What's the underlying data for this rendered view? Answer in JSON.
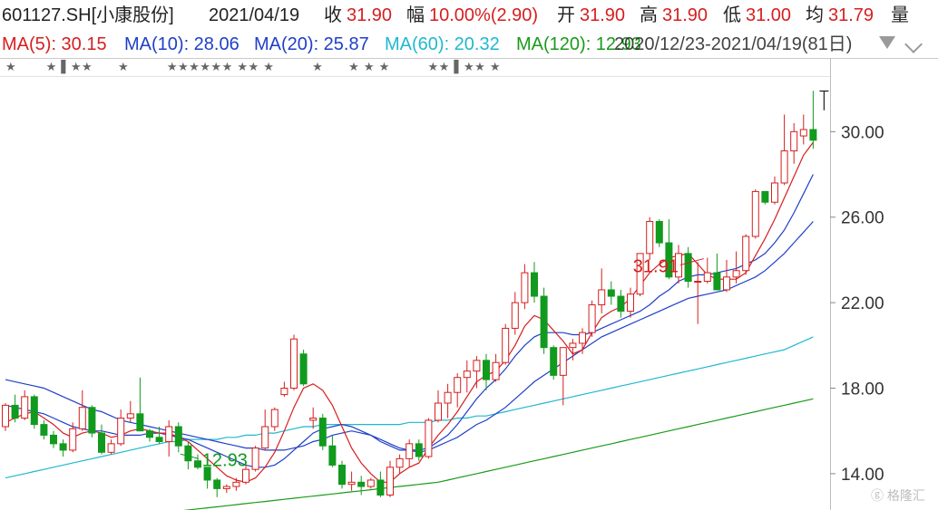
{
  "header": {
    "stock": "601127.SH[小康股份]",
    "date": "2021/04/19",
    "close_label": "收",
    "close": "31.90",
    "change_label": "幅",
    "change": "10.00%(2.90)",
    "open_label": "开",
    "open": "31.90",
    "high_label": "高",
    "high": "31.90",
    "low_label": "低",
    "low": "31.00",
    "avg_label": "均",
    "avg": "31.79",
    "vol_label": "量",
    "range": "2020/12/23-2021/04/19(81日)"
  },
  "ma_legend": [
    {
      "text": "MA(5): 30.15",
      "color": "#d61e1e"
    },
    {
      "text": "MA(10): 28.06",
      "color": "#1f3fc8"
    },
    {
      "text": "MA(20): 25.87",
      "color": "#1f3fc8"
    },
    {
      "text": "MA(60): 20.32",
      "color": "#1fb8d0"
    },
    {
      "text": "MA(120): 12.93",
      "color": "#1a9a1a"
    }
  ],
  "watermark": "ⓖ 格隆汇",
  "chart_data": {
    "type": "candlestick",
    "ylim": [
      12.3,
      32.6
    ],
    "yticks": [
      "30.00",
      "26.00",
      "22.00",
      "18.00",
      "14.00"
    ],
    "ytick_values": [
      30,
      26,
      22,
      18,
      14
    ],
    "colors": {
      "up": "#d61e1e",
      "down": "#119a1e",
      "ma5": "#d61e1e",
      "ma10": "#1f3fc8",
      "ma20": "#1f3fc8",
      "ma60": "#1fb8d0",
      "ma120": "#1a9a1a",
      "ma250": "#b21fb2"
    },
    "annotations": [
      {
        "text": "31.91",
        "type": "high",
        "color": "#d61e1e",
        "index": 73
      },
      {
        "text": "12.93",
        "type": "low",
        "color": "#119a1e",
        "index": 18
      }
    ],
    "stars": "★       ★ ▌★★      ★         ★★★★★★ ★★ ★         ★      ★ ★ ★         ★★ ▌★★ ★",
    "candles": [
      [
        16.2,
        17.3,
        16.0,
        17.2
      ],
      [
        17.2,
        17.7,
        16.4,
        16.6
      ],
      [
        16.6,
        17.9,
        16.5,
        17.6
      ],
      [
        17.6,
        17.7,
        16.1,
        16.3
      ],
      [
        16.3,
        16.5,
        15.6,
        15.8
      ],
      [
        15.8,
        16.0,
        15.2,
        15.4
      ],
      [
        15.4,
        15.6,
        14.8,
        15.1
      ],
      [
        15.1,
        16.4,
        15.0,
        16.1
      ],
      [
        16.1,
        17.9,
        16.0,
        17.1
      ],
      [
        17.1,
        17.2,
        15.7,
        15.9
      ],
      [
        15.9,
        16.3,
        14.9,
        15.0
      ],
      [
        15.0,
        15.6,
        14.9,
        15.4
      ],
      [
        15.4,
        17.0,
        15.3,
        16.6
      ],
      [
        16.6,
        17.4,
        16.4,
        16.8
      ],
      [
        16.8,
        18.5,
        16.4,
        16.0
      ],
      [
        16.0,
        16.1,
        15.5,
        15.7
      ],
      [
        15.7,
        16.2,
        15.4,
        15.5
      ],
      [
        15.5,
        16.5,
        14.8,
        16.2
      ],
      [
        16.2,
        16.4,
        15.0,
        15.3
      ],
      [
        15.3,
        15.5,
        14.2,
        14.6
      ],
      [
        14.6,
        14.9,
        14.2,
        14.3
      ],
      [
        14.3,
        14.3,
        13.3,
        13.7
      ],
      [
        13.7,
        13.8,
        12.9,
        13.3
      ],
      [
        13.3,
        13.5,
        13.1,
        13.4
      ],
      [
        13.4,
        13.8,
        13.2,
        13.6
      ],
      [
        13.6,
        14.4,
        13.5,
        14.2
      ],
      [
        14.2,
        15.3,
        14.1,
        15.2
      ],
      [
        15.2,
        17.0,
        15.1,
        16.2
      ],
      [
        16.2,
        17.1,
        16.0,
        17.0
      ],
      [
        17.7,
        18.3,
        17.6,
        18.0
      ],
      [
        18.0,
        20.5,
        17.9,
        20.3
      ],
      [
        19.6,
        19.8,
        18.1,
        18.2
      ],
      [
        16.5,
        17.1,
        16.1,
        16.6
      ],
      [
        16.6,
        16.8,
        15.1,
        15.3
      ],
      [
        15.3,
        15.8,
        14.3,
        14.4
      ],
      [
        14.4,
        14.6,
        13.3,
        13.5
      ],
      [
        13.5,
        14.1,
        13.2,
        13.6
      ],
      [
        13.6,
        13.9,
        13.0,
        13.4
      ],
      [
        13.4,
        13.8,
        13.3,
        13.7
      ],
      [
        13.7,
        14.1,
        12.9,
        13.0
      ],
      [
        13.0,
        14.6,
        12.9,
        14.3
      ],
      [
        14.3,
        14.9,
        14.0,
        14.7
      ],
      [
        14.7,
        15.6,
        14.3,
        15.4
      ],
      [
        15.4,
        15.6,
        14.6,
        14.8
      ],
      [
        14.8,
        16.6,
        14.7,
        16.5
      ],
      [
        16.5,
        17.9,
        16.4,
        17.3
      ],
      [
        17.3,
        18.2,
        16.6,
        17.8
      ],
      [
        17.8,
        18.7,
        17.1,
        18.5
      ],
      [
        18.5,
        19.3,
        17.8,
        18.8
      ],
      [
        18.8,
        19.5,
        18.0,
        19.3
      ],
      [
        19.3,
        19.6,
        17.9,
        18.4
      ],
      [
        18.4,
        19.6,
        18.3,
        19.2
      ],
      [
        19.2,
        21.0,
        19.1,
        20.8
      ],
      [
        20.8,
        22.5,
        20.5,
        22.0
      ],
      [
        22.0,
        23.8,
        21.7,
        23.4
      ],
      [
        23.4,
        23.9,
        22.0,
        22.3
      ],
      [
        22.3,
        22.7,
        19.6,
        19.9
      ],
      [
        19.9,
        20.0,
        18.4,
        18.6
      ],
      [
        18.6,
        19.5,
        17.2,
        19.9
      ],
      [
        19.9,
        20.3,
        19.3,
        20.1
      ],
      [
        20.1,
        20.8,
        19.6,
        20.6
      ],
      [
        20.6,
        22.1,
        20.4,
        21.9
      ],
      [
        21.9,
        23.6,
        21.5,
        22.6
      ],
      [
        22.6,
        23.0,
        21.9,
        22.3
      ],
      [
        22.3,
        22.6,
        21.3,
        21.6
      ],
      [
        21.6,
        22.7,
        21.3,
        22.4
      ],
      [
        22.4,
        23.6,
        22.3,
        24.3
      ],
      [
        24.3,
        26.0,
        24.0,
        25.8
      ],
      [
        25.8,
        25.9,
        24.6,
        24.8
      ],
      [
        24.8,
        25.9,
        23.1,
        23.2
      ],
      [
        23.2,
        24.7,
        22.9,
        24.3
      ],
      [
        24.3,
        24.6,
        22.7,
        23.0
      ],
      [
        23.0,
        23.9,
        21.0,
        23.0
      ],
      [
        23.0,
        24.1,
        22.9,
        23.4
      ],
      [
        23.4,
        24.3,
        22.6,
        22.6
      ],
      [
        22.6,
        24.0,
        22.5,
        23.2
      ],
      [
        23.2,
        24.4,
        22.9,
        23.5
      ],
      [
        23.5,
        25.2,
        23.3,
        25.1
      ],
      [
        25.1,
        27.3,
        25.0,
        27.2
      ],
      [
        27.2,
        27.2,
        26.6,
        26.7
      ],
      [
        26.7,
        27.9,
        26.6,
        27.6
      ],
      [
        27.6,
        30.8,
        27.5,
        29.1
      ],
      [
        29.1,
        30.4,
        28.5,
        30.0
      ],
      [
        29.8,
        30.8,
        29.4,
        30.1
      ],
      [
        30.1,
        31.91,
        29.2,
        29.6
      ]
    ],
    "ma5": [
      16.4,
      16.6,
      16.8,
      16.9,
      16.6,
      16.3,
      15.9,
      15.7,
      15.9,
      16.0,
      15.9,
      15.7,
      15.8,
      16.0,
      16.1,
      16.0,
      15.9,
      15.9,
      15.7,
      15.5,
      15.1,
      14.7,
      14.3,
      13.9,
      13.7,
      13.6,
      13.8,
      14.3,
      15.0,
      16.0,
      17.1,
      18.0,
      18.2,
      17.9,
      17.2,
      16.2,
      15.2,
      14.5,
      14.0,
      13.6,
      13.6,
      14.0,
      14.3,
      14.5,
      15.2,
      15.8,
      16.3,
      16.9,
      17.6,
      18.3,
      18.6,
      18.8,
      19.3,
      20.0,
      20.9,
      21.4,
      21.2,
      20.7,
      20.2,
      19.6,
      19.8,
      20.6,
      21.3,
      21.6,
      21.8,
      22.2,
      22.8,
      23.4,
      23.8,
      24.1,
      24.2,
      24.3,
      23.8,
      23.3,
      23.1,
      23.1,
      23.1,
      23.4,
      24.2,
      25.0,
      25.9,
      26.9,
      27.9,
      28.9,
      29.5
    ],
    "ma10": [
      17.2,
      17.1,
      17.0,
      16.9,
      16.8,
      16.6,
      16.4,
      16.2,
      16.1,
      16.0,
      16.0,
      15.9,
      15.8,
      15.8,
      15.8,
      15.9,
      15.9,
      15.8,
      15.7,
      15.6,
      15.4,
      15.2,
      15.0,
      14.8,
      14.6,
      14.4,
      14.3,
      14.3,
      14.4,
      14.7,
      15.1,
      15.5,
      15.9,
      16.1,
      16.2,
      16.3,
      16.2,
      16.0,
      15.8,
      15.5,
      15.3,
      15.1,
      15.1,
      15.1,
      15.2,
      15.5,
      15.8,
      16.3,
      16.9,
      17.5,
      18.0,
      18.4,
      18.9,
      19.5,
      20.0,
      20.4,
      20.6,
      20.6,
      20.6,
      20.5,
      20.5,
      20.6,
      20.8,
      21.0,
      21.2,
      21.4,
      21.6,
      21.9,
      22.3,
      22.6,
      23.0,
      23.2,
      23.3,
      23.3,
      23.4,
      23.5,
      23.6,
      23.8,
      24.0,
      24.3,
      24.8,
      25.4,
      26.2,
      27.1,
      28.0
    ],
    "ma20": [
      18.4,
      18.3,
      18.2,
      18.1,
      18.0,
      17.8,
      17.6,
      17.4,
      17.2,
      17.0,
      16.9,
      16.7,
      16.5,
      16.4,
      16.3,
      16.2,
      16.1,
      16.0,
      15.9,
      15.8,
      15.7,
      15.6,
      15.5,
      15.4,
      15.3,
      15.2,
      15.2,
      15.1,
      15.1,
      15.1,
      15.2,
      15.3,
      15.5,
      15.6,
      15.8,
      15.9,
      16.0,
      15.9,
      15.8,
      15.6,
      15.4,
      15.2,
      15.1,
      15.0,
      15.1,
      15.3,
      15.5,
      15.7,
      16.0,
      16.3,
      16.5,
      16.8,
      17.1,
      17.5,
      17.9,
      18.3,
      18.6,
      18.9,
      19.2,
      19.5,
      19.8,
      20.1,
      20.4,
      20.6,
      20.8,
      21.0,
      21.2,
      21.4,
      21.6,
      21.8,
      22.0,
      22.2,
      22.3,
      22.4,
      22.5,
      22.6,
      22.8,
      23.0,
      23.2,
      23.5,
      23.9,
      24.3,
      24.8,
      25.3,
      25.8
    ],
    "ma60": [
      13.8,
      13.9,
      14.0,
      14.1,
      14.2,
      14.3,
      14.4,
      14.5,
      14.6,
      14.7,
      14.8,
      14.9,
      15.0,
      15.1,
      15.2,
      15.3,
      15.4,
      15.5,
      15.5,
      15.6,
      15.6,
      15.6,
      15.6,
      15.7,
      15.7,
      15.8,
      15.8,
      15.9,
      15.9,
      16.0,
      16.1,
      16.2,
      16.2,
      16.3,
      16.3,
      16.3,
      16.3,
      16.3,
      16.3,
      16.3,
      16.3,
      16.3,
      16.4,
      16.4,
      16.4,
      16.5,
      16.5,
      16.6,
      16.6,
      16.7,
      16.7,
      16.8,
      16.9,
      17.0,
      17.1,
      17.2,
      17.3,
      17.4,
      17.5,
      17.6,
      17.7,
      17.8,
      17.9,
      18.0,
      18.1,
      18.2,
      18.3,
      18.4,
      18.5,
      18.6,
      18.7,
      18.8,
      18.9,
      19.0,
      19.1,
      19.2,
      19.3,
      19.4,
      19.5,
      19.6,
      19.7,
      19.8,
      20.0,
      20.2,
      20.4
    ],
    "ma120": [
      null,
      null,
      null,
      null,
      null,
      null,
      null,
      null,
      null,
      null,
      null,
      null,
      null,
      null,
      null,
      null,
      null,
      12.2,
      12.25,
      12.3,
      12.35,
      12.4,
      12.45,
      12.5,
      12.55,
      12.6,
      12.65,
      12.7,
      12.75,
      12.8,
      12.85,
      12.9,
      12.95,
      13.0,
      13.05,
      13.1,
      13.15,
      13.2,
      13.25,
      13.3,
      13.35,
      13.4,
      13.45,
      13.5,
      13.55,
      13.6,
      13.7,
      13.8,
      13.9,
      14.0,
      14.1,
      14.2,
      14.3,
      14.4,
      14.5,
      14.6,
      14.7,
      14.8,
      14.9,
      15.0,
      15.1,
      15.2,
      15.3,
      15.4,
      15.5,
      15.6,
      15.7,
      15.8,
      15.9,
      16.0,
      16.1,
      16.2,
      16.3,
      16.4,
      16.5,
      16.6,
      16.7,
      16.8,
      16.9,
      17.0,
      17.1,
      17.2,
      17.3,
      17.4,
      17.5
    ],
    "ma250": [
      null,
      null,
      null,
      null,
      null,
      null,
      null,
      null,
      null,
      null,
      null,
      null,
      null,
      null,
      null,
      null,
      null,
      null,
      null,
      null,
      null,
      null,
      null,
      null,
      null,
      null,
      null,
      null,
      null,
      null,
      null,
      null,
      null,
      null,
      null,
      null,
      null,
      null,
      null,
      null,
      null,
      null,
      null,
      null,
      null,
      null,
      null,
      null,
      null,
      null,
      null,
      null,
      null,
      null,
      null,
      null,
      null,
      null,
      null,
      null,
      null,
      null,
      null,
      null,
      null,
      null,
      null,
      null,
      null,
      null,
      null,
      null,
      null,
      null,
      null,
      null,
      null,
      null,
      null,
      null,
      null,
      null,
      null,
      null,
      null
    ]
  }
}
